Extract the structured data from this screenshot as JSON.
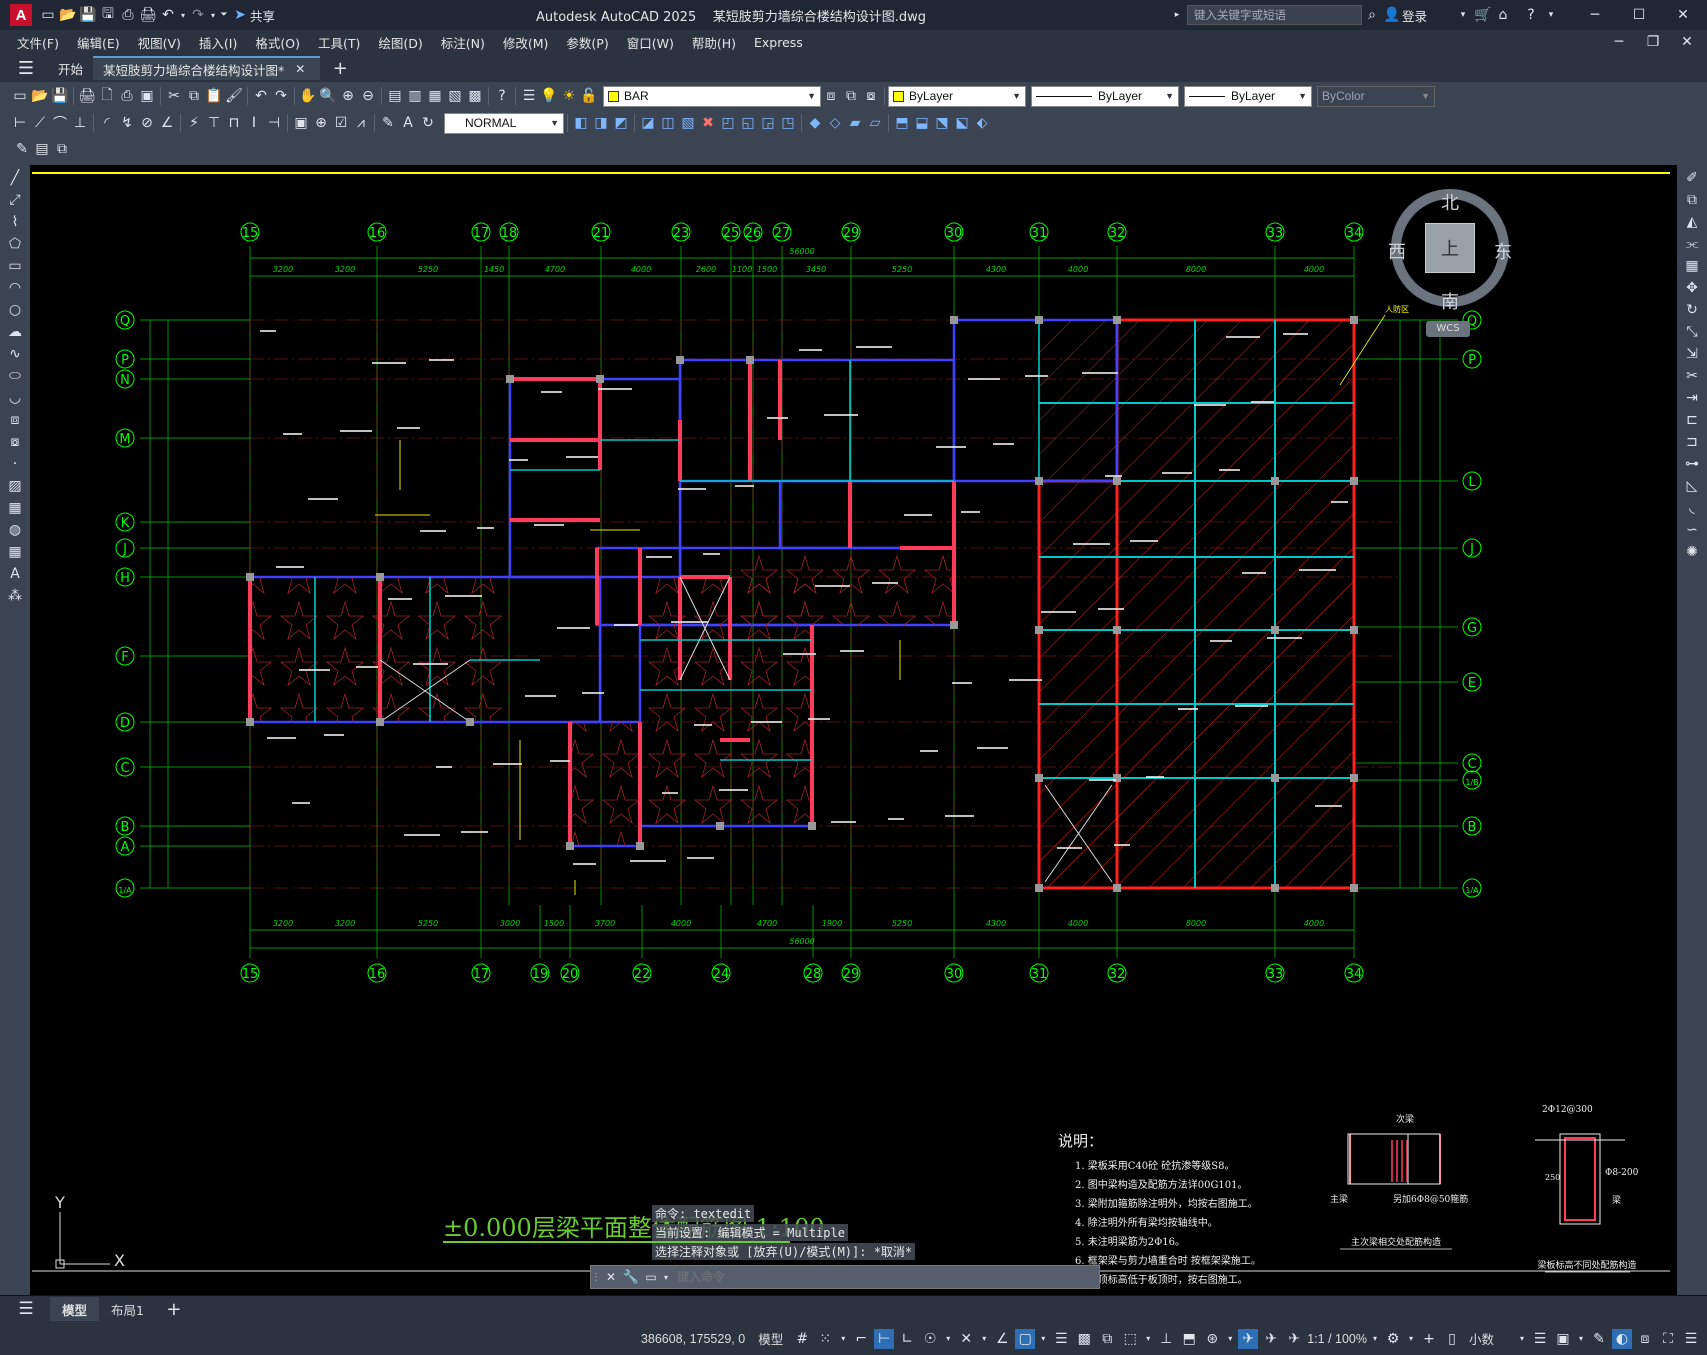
{
  "app_title": "Autodesk AutoCAD 2025",
  "file_title": "某短肢剪力墙综合楼结构设计图.dwg",
  "share_label": "共享",
  "search_placeholder": "键入关键字或短语",
  "login_label": "登录",
  "menu": [
    "文件(F)",
    "编辑(E)",
    "视图(V)",
    "插入(I)",
    "格式(O)",
    "工具(T)",
    "绘图(D)",
    "标注(N)",
    "修改(M)",
    "参数(P)",
    "窗口(W)",
    "帮助(H)",
    "Express"
  ],
  "tabs": {
    "home": "开始",
    "doc": "某短肢剪力墙综合楼结构设计图*"
  },
  "toolbar": {
    "layer_name": "BAR",
    "color": "ByLayer",
    "linetype": "ByLayer",
    "lineweight": "ByLayer",
    "plotstyle": "ByColor",
    "textstyle": "NORMAL"
  },
  "compass": {
    "north": "北",
    "south": "南",
    "east": "东",
    "west": "西",
    "top": "上",
    "wcs": "WCS"
  },
  "drawing": {
    "top_axes": [
      [
        "15",
        250
      ],
      [
        "16",
        377
      ],
      [
        "17",
        481
      ],
      [
        "18",
        509
      ],
      [
        "21",
        601
      ],
      [
        "23",
        681
      ],
      [
        "25",
        731
      ],
      [
        "26",
        753
      ],
      [
        "27",
        782
      ],
      [
        "29",
        851
      ],
      [
        "30",
        954
      ],
      [
        "31",
        1039
      ],
      [
        "32",
        1117
      ],
      [
        "33",
        1275
      ],
      [
        "34",
        1354
      ]
    ],
    "bottom_axes": [
      [
        "15",
        250
      ],
      [
        "16",
        377
      ],
      [
        "17",
        481
      ],
      [
        "19",
        540
      ],
      [
        "20",
        570
      ],
      [
        "22",
        642
      ],
      [
        "24",
        721
      ],
      [
        "28",
        813
      ],
      [
        "29",
        851
      ],
      [
        "30",
        954
      ],
      [
        "31",
        1039
      ],
      [
        "32",
        1117
      ],
      [
        "33",
        1275
      ],
      [
        "34",
        1354
      ]
    ],
    "left_axes": [
      [
        "Q",
        320
      ],
      [
        "P",
        359
      ],
      [
        "N",
        379
      ],
      [
        "M",
        438
      ],
      [
        "K",
        522
      ],
      [
        "J",
        548
      ],
      [
        "H",
        577
      ],
      [
        "F",
        656
      ],
      [
        "D",
        722
      ],
      [
        "C",
        767
      ],
      [
        "B",
        826
      ],
      [
        "A",
        846
      ],
      [
        "1/A",
        888
      ]
    ],
    "right_axes": [
      [
        "Q",
        320
      ],
      [
        "P",
        359
      ],
      [
        "L",
        481
      ],
      [
        "J",
        548
      ],
      [
        "G",
        627
      ],
      [
        "E",
        682
      ],
      [
        "C",
        763
      ],
      [
        "1/B",
        780
      ],
      [
        "B",
        826
      ],
      [
        "1/A",
        888
      ]
    ],
    "top_dims": [
      [
        "3200",
        283
      ],
      [
        "3200",
        345
      ],
      [
        "5250",
        428
      ],
      [
        "1450",
        494
      ],
      [
        "4700",
        555
      ],
      [
        "4000",
        641
      ],
      [
        "2600",
        706
      ],
      [
        "1100",
        742
      ],
      [
        "1500",
        767
      ],
      [
        "3450",
        816
      ],
      [
        "5250",
        902
      ],
      [
        "4300",
        996
      ],
      [
        "4000",
        1078
      ],
      [
        "8000",
        1196
      ],
      [
        "4000",
        1314
      ]
    ],
    "top_total": "56000",
    "bottom_dims": [
      [
        "3200",
        283
      ],
      [
        "3200",
        345
      ],
      [
        "5250",
        428
      ],
      [
        "3000",
        510
      ],
      [
        "1500",
        554
      ],
      [
        "3700",
        605
      ],
      [
        "4000",
        681
      ],
      [
        "4700",
        767
      ],
      [
        "1900",
        832
      ],
      [
        "5250",
        902
      ],
      [
        "4300",
        996
      ],
      [
        "4000",
        1078
      ],
      [
        "8000",
        1196
      ],
      [
        "4000",
        1314
      ]
    ],
    "bottom_total": "56000",
    "plan_title": "±0.000层梁平面整体配筋图 1:100",
    "notes_title": "说明：",
    "notes": [
      "1. 梁板采用C40砼 砼抗渗等级S8。",
      "2. 图中梁构造及配筋方法详00G101。",
      "3. 梁附加箍筋除注明外，均按右图施工。",
      "4. 除注明外所有梁均按轴线中。",
      "5. 未注明梁筋为2Φ16。",
      "6. 框架梁与剪力墙重合时 按框架梁施工。",
      "7. 梁顶标高低于板顶时，按右图施工。"
    ],
    "detail1_caption": "主次梁相交处配筋构造",
    "detail1_top": "次梁",
    "detail1_left": "主梁",
    "detail1_right": "另加6Φ8@50箍筋",
    "detail2_caption": "梁板标高不同处配筋构造",
    "detail2_top": "2Φ12@300",
    "detail2_right": "Φ8-200",
    "detail2_dim": "250",
    "detail2_bot": "梁",
    "rp_label": "人防区",
    "ucs_x": "X",
    "ucs_y": "Y"
  },
  "command": {
    "history": [
      "命令: textedit",
      "当前设置: 编辑模式 = Multiple",
      "选择注释对象或 [放弃(U)/模式(M)]: *取消*"
    ],
    "placeholder": "键入命令"
  },
  "layouts": {
    "model": "模型",
    "layout1": "布局1"
  },
  "status": {
    "coords": "386608, 175529, 0",
    "model": "模型",
    "scale": "1:1 / 100%",
    "units": "小数"
  }
}
